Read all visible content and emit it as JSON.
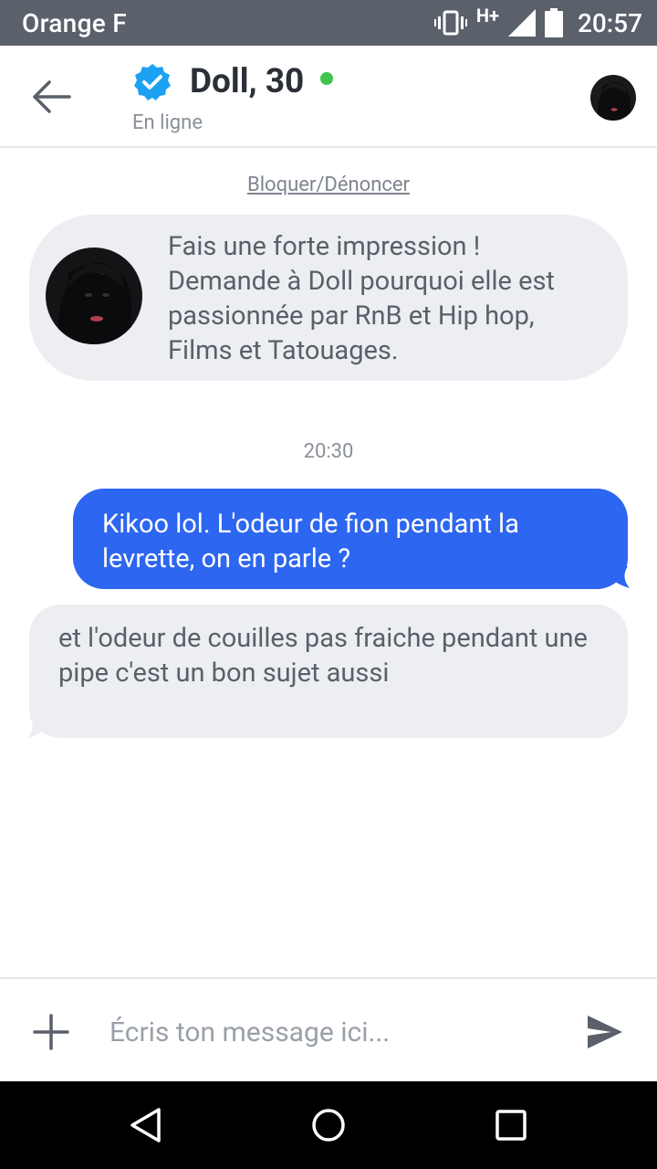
{
  "status_bar": {
    "carrier": "Orange F",
    "network_type": "H+",
    "time": "20:57",
    "icons": [
      "vibrate-icon",
      "signal-icon",
      "battery-icon"
    ]
  },
  "header": {
    "contact_name": "Doll, 30",
    "status": "En ligne",
    "verified": true,
    "online": true,
    "colors": {
      "verified": "#1da1f2",
      "online": "#3ec44f"
    }
  },
  "chat": {
    "block_report_label": "Bloquer/Dénoncer",
    "prompt": "Fais une forte impression ! Demande à Doll pourquoi elle est passionnée par RnB et Hip hop, Films et Tatouages.",
    "timestamp": "20:30",
    "messages": [
      {
        "direction": "outgoing",
        "text": "Kikoo lol. L'odeur de fion pendant la levrette, on en parle ?"
      },
      {
        "direction": "incoming",
        "text": "et l'odeur de couilles pas fraiche pendant une pipe c'est un bon sujet aussi"
      }
    ],
    "colors": {
      "outgoing_bubble": "#2d66f0",
      "incoming_bubble": "#eceef2"
    }
  },
  "composer": {
    "placeholder": "Écris ton message ici..."
  },
  "nav": {
    "icons": [
      "back-triangle-icon",
      "home-circle-icon",
      "recents-square-icon"
    ]
  }
}
